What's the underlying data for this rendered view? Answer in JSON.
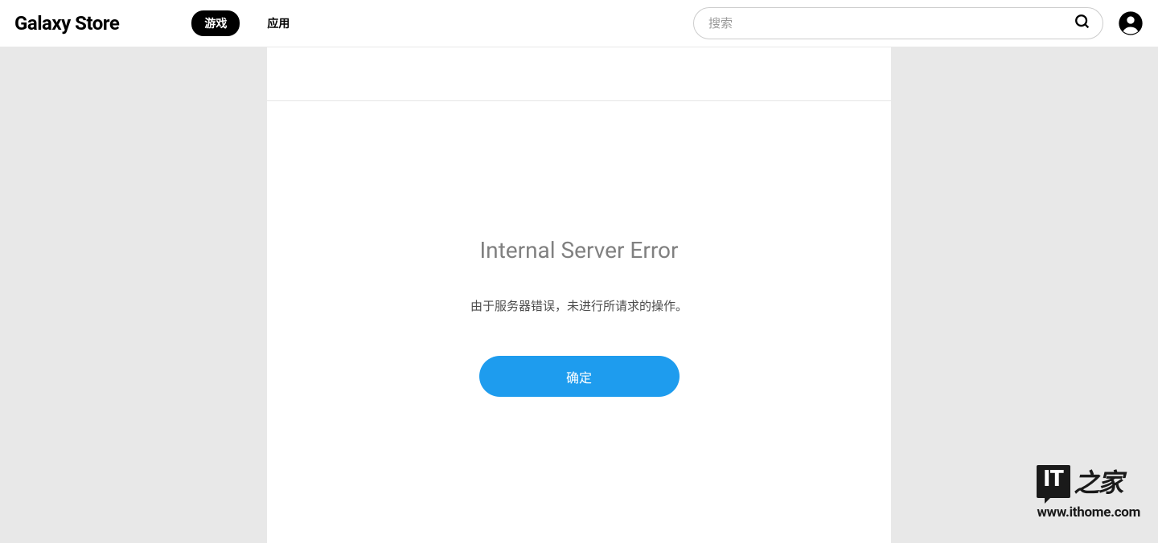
{
  "header": {
    "logo": "Galaxy Store",
    "tabs": {
      "games": "游戏",
      "apps": "应用"
    },
    "search_placeholder": "搜索"
  },
  "error": {
    "title": "Internal Server Error",
    "message": "由于服务器错误，未进行所请求的操作。",
    "confirm_label": "确定"
  },
  "watermark": {
    "badge": "IT",
    "suffix": "之家",
    "url": "www.ithome.com"
  }
}
